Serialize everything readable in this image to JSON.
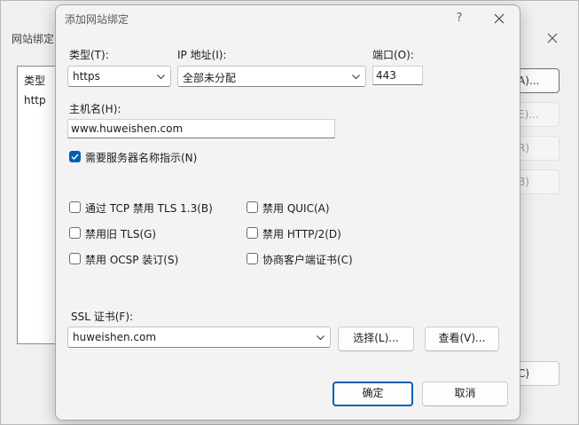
{
  "background_window": {
    "title": "网站绑定",
    "list_header": "类型",
    "list_row": "http",
    "buttons": [
      "A)...",
      "E)...",
      "R)",
      "B)",
      "C)"
    ]
  },
  "dialog": {
    "title": "添加网站绑定",
    "help": "?",
    "type": {
      "label": "类型(T):",
      "value": "https"
    },
    "ip": {
      "label": "IP 地址(I):",
      "value": "全部未分配"
    },
    "port": {
      "label": "端口(O):",
      "value": "443"
    },
    "hostname": {
      "label": "主机名(H):",
      "value": "www.huweishen.com"
    },
    "sni": {
      "label": "需要服务器名称指示(N)",
      "checked": true
    },
    "options": {
      "disable_tls13": "通过 TCP 禁用 TLS 1.3(B)",
      "disable_legacy_tls": "禁用旧 TLS(G)",
      "disable_ocsp": "禁用 OCSP 装订(S)",
      "disable_quic": "禁用 QUIC(A)",
      "disable_http2": "禁用 HTTP/2(D)",
      "negotiate_client_cert": "协商客户端证书(C)"
    },
    "ssl": {
      "label": "SSL 证书(F):",
      "value": "huweishen.com"
    },
    "select_button": "选择(L)...",
    "view_button": "查看(V)...",
    "ok_button": "确定",
    "cancel_button": "取消"
  },
  "colors": {
    "accent": "#005fb8"
  }
}
